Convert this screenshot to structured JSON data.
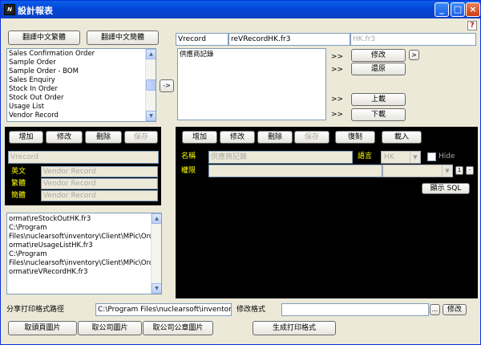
{
  "window": {
    "title": "設計報表"
  },
  "top_buttons": {
    "trad": "翻譯中文繁體",
    "simp": "翻譯中文簡體"
  },
  "report_list": {
    "items": [
      "Sales Confirmation Order",
      "Sample Order",
      "Sample Order - BOM",
      "Sales Enquiry",
      "Stock In Order",
      "Stock Out Order",
      "Usage List",
      "Vendor Record"
    ]
  },
  "move_button": "->",
  "selected_header": {
    "code": "Vrecord",
    "file": "reVRecordHK.fr3",
    "file_gray": "HK.fr3"
  },
  "selected_list": {
    "items": [
      "供應商記錄"
    ]
  },
  "arrows": {
    "a1": ">>",
    "a2": ">>",
    "a3": ">>",
    "a4": ">>"
  },
  "right_buttons": {
    "edit": "修改",
    "edit_more": ">",
    "restore": "還原",
    "upload": "上載",
    "download": "下載"
  },
  "left_panel": {
    "add": "增加",
    "edit": "修改",
    "delete": "刪除",
    "save": "保存",
    "code_value": "Vrecord",
    "rows": [
      {
        "label": "英文",
        "value": "Vendor Record"
      },
      {
        "label": "繁體",
        "value": "Vendor Record"
      },
      {
        "label": "簡體",
        "value": "Vendor Record"
      }
    ]
  },
  "path_list": {
    "lines": [
      "ormat\\reStockOutHK.fr3",
      "C:\\Program",
      "Files\\nuclearsoft\\inventory\\Client\\MPic\\OrderF",
      "ormat\\reUsageListHK.fr3",
      "C:\\Program",
      "Files\\nuclearsoft\\inventory\\Client\\MPic\\OrderF",
      "ormat\\reVRecordHK.fr3"
    ]
  },
  "right_panel": {
    "add": "增加",
    "edit": "修改",
    "delete": "刪除",
    "save": "保存",
    "copy": "復制",
    "load": "載入",
    "name_label": "名稱",
    "name_value": "供應商記錄",
    "lang_label": "語言",
    "lang_value": "HK",
    "hide_label": "Hide",
    "perm_label": "權限",
    "perm_btn_a": "1",
    "perm_btn_b": "-",
    "show_sql": "顯示 SQL"
  },
  "bottom": {
    "share_label": "分享打印格式路徑",
    "share_value": "C:\\Program Files\\nuclearsoft\\inventory\\",
    "modify_label": "修改格式",
    "modify_value": "",
    "browse": "...",
    "modify_btn": "修改",
    "btn_page_img": "取頭頁圖片",
    "btn_co_img": "取公司圖片",
    "btn_seal_img": "取公司公章圖片",
    "btn_generate": "生成打印格式"
  },
  "icons": {
    "app": "app-icon",
    "minimize": "minimize-icon",
    "maximize": "maximize-icon",
    "close": "close-icon",
    "help": "help-icon"
  }
}
